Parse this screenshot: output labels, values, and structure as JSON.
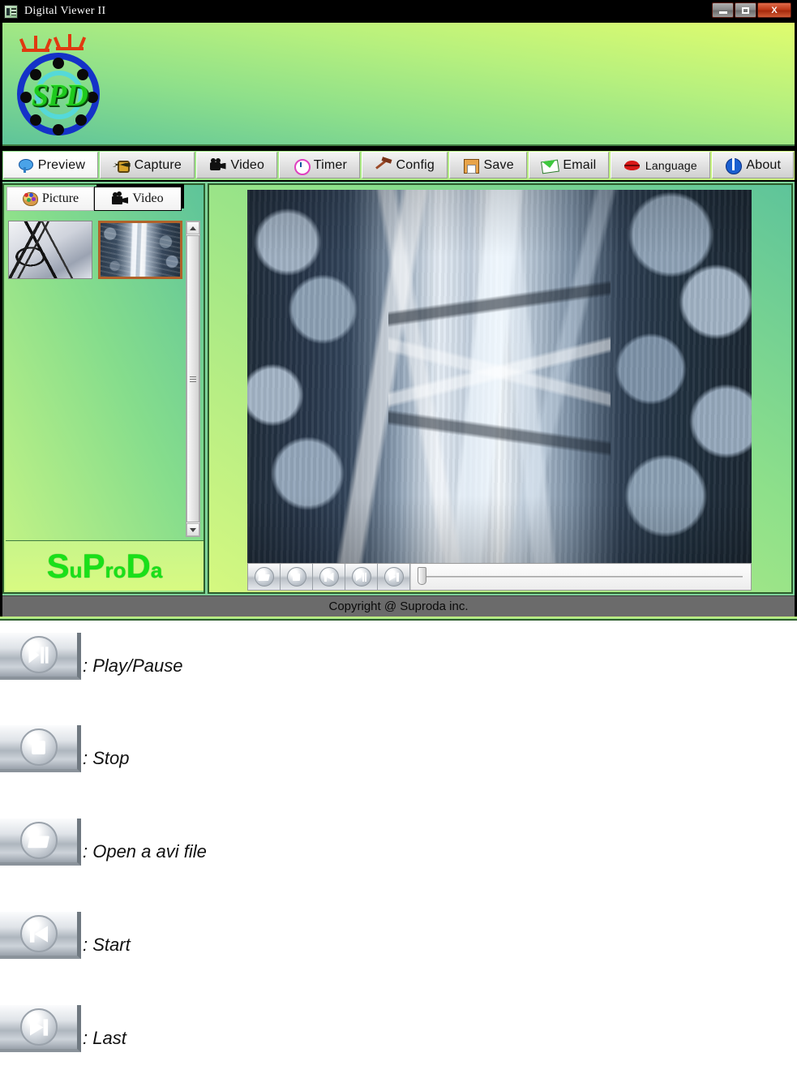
{
  "window": {
    "title": "Digital Viewer II",
    "icon": "app-icon",
    "controls": {
      "minimize_label": "_",
      "maximize_label": "□",
      "close_label": "X"
    }
  },
  "header": {
    "logo_text": "SPD",
    "logo_name": "spd-logo"
  },
  "toolbar": {
    "items": [
      {
        "label": "Preview",
        "icon": "speech-balloon-icon",
        "active": true
      },
      {
        "label": "Capture",
        "icon": "camera-icon",
        "active": false
      },
      {
        "label": "Video",
        "icon": "movie-camera-icon",
        "active": false
      },
      {
        "label": "Timer",
        "icon": "clock-icon",
        "active": false
      },
      {
        "label": "Config",
        "icon": "hammer-icon",
        "active": false
      },
      {
        "label": "Save",
        "icon": "floppy-disk-icon",
        "active": false
      },
      {
        "label": "Email",
        "icon": "envelope-icon",
        "active": false
      },
      {
        "label": "Language",
        "icon": "lips-icon",
        "active": false
      },
      {
        "label": "About",
        "icon": "info-circle-icon",
        "active": false
      }
    ]
  },
  "sidebar": {
    "tabs": [
      {
        "label": "Picture",
        "icon": "palette-icon",
        "selected": false
      },
      {
        "label": "Video",
        "icon": "movie-camera-icon",
        "selected": true
      }
    ],
    "thumbnails": [
      {
        "name": "thumbnail-wires",
        "selected": false
      },
      {
        "name": "thumbnail-fibers",
        "selected": true
      }
    ],
    "scrollbar": {
      "up_arrow": "scroll-up-arrow",
      "down_arrow": "scroll-down-arrow"
    },
    "brand": {
      "part1": "S",
      "part2": "u",
      "part3": "P",
      "part4": "ro",
      "part5": "D",
      "part6": "a"
    }
  },
  "player": {
    "buttons": [
      {
        "name": "open-file-button",
        "icon": "folder-icon",
        "tooltip": "Open a avi file"
      },
      {
        "name": "stop-button",
        "icon": "stop-icon",
        "tooltip": "Stop"
      },
      {
        "name": "start-button",
        "icon": "start-icon",
        "tooltip": "Start"
      },
      {
        "name": "play-pause-button",
        "icon": "play-pause-icon",
        "tooltip": "Play/Pause"
      },
      {
        "name": "last-button",
        "icon": "last-icon",
        "tooltip": "Last"
      }
    ],
    "seek_position": "0"
  },
  "status": {
    "copyright": "Copyright @ Suproda inc."
  },
  "legend": {
    "items": [
      {
        "icon": "play-pause-icon",
        "label": ": Play/Pause"
      },
      {
        "icon": "stop-icon",
        "label": ": Stop"
      },
      {
        "icon": "folder-icon",
        "label": ": Open a avi file"
      },
      {
        "icon": "start-icon",
        "label": ": Start"
      },
      {
        "icon": "last-icon",
        "label": ": Last"
      }
    ]
  },
  "colors": {
    "header_green_light": "#e0fc6e",
    "header_green_teal": "#5ec49a",
    "brand_green": "#19e019",
    "logo_blue": "#1432c8",
    "logo_cyan": "#55d9d9",
    "crown_red": "#e03a10",
    "selection_orange": "#b0622a",
    "status_gray": "#6b6b6b",
    "titlebar_black": "#000000",
    "close_red": "#c03a18"
  }
}
